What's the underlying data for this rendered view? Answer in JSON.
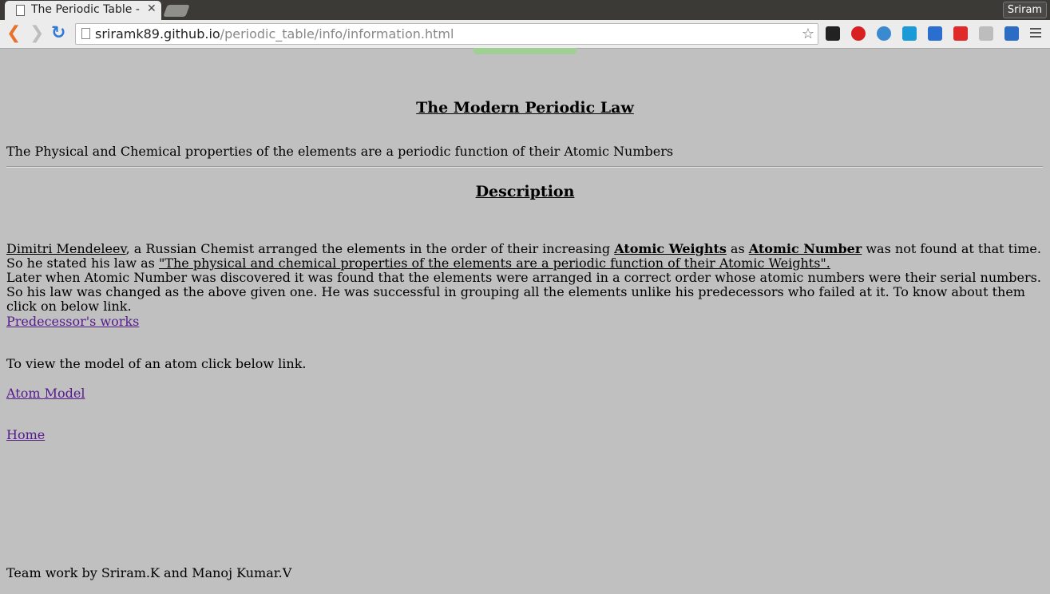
{
  "browser": {
    "tab_title": "The Periodic Table - I",
    "close_glyph": "✕",
    "user_name": "Sriram",
    "url_host": "sriramk89.github.io",
    "url_path": "/periodic_table/info/information.html",
    "back_glyph": "❮",
    "forward_glyph": "❯",
    "reload_glyph": "↻",
    "star_glyph": "☆",
    "extensions": [
      {
        "icon": "s-extension-icon",
        "color": "#222222"
      },
      {
        "icon": "opera-icon",
        "color": "#d82020"
      },
      {
        "icon": "globe-icon",
        "color": "#3a8ad0"
      },
      {
        "icon": "chart-extension-icon",
        "color": "#1a9ad6"
      },
      {
        "icon": "megaphone-icon",
        "color": "#2a6fd0"
      },
      {
        "icon": "red-extension-icon",
        "color": "#e02a2a"
      },
      {
        "icon": "layout-icon",
        "color": "#bdbdbd"
      },
      {
        "icon": "download-icon",
        "color": "#2b6cc4"
      }
    ]
  },
  "page": {
    "title": "The Modern Periodic Law",
    "law_statement": "The Physical and Chemical properties of the elements are a periodic function of their Atomic Numbers",
    "description_heading": "Description",
    "desc": {
      "mendeleev": "Dimitri Mendeleev",
      "part1": ", a Russian Chemist arranged the elements in the order of their increasing ",
      "atomic_weights": "Atomic Weights",
      "part2": " as ",
      "atomic_number": "Atomic Number",
      "part3": " was not found at that time. So he stated his law as ",
      "quote": "\"The physical and chemical properties of the elements are a periodic function of their Atomic Weights\".",
      "part4": "Later when Atomic Number was discovered it was found that the elements were arranged in a correct order whose atomic numbers were their serial numbers. So his law was changed as the above given one. He was successful in grouping all the elements unlike his predecessors who failed at it. To know about them click on below link."
    },
    "predecessor_link": "Predecessor's works",
    "atom_text": "To view the model of an atom click below link.",
    "atom_link": "Atom Model",
    "home_link": "Home",
    "footer": "Team work by Sriram.K and Manoj Kumar.V",
    "link_color": "#551a8b",
    "background_color": "#c0c0c0"
  }
}
